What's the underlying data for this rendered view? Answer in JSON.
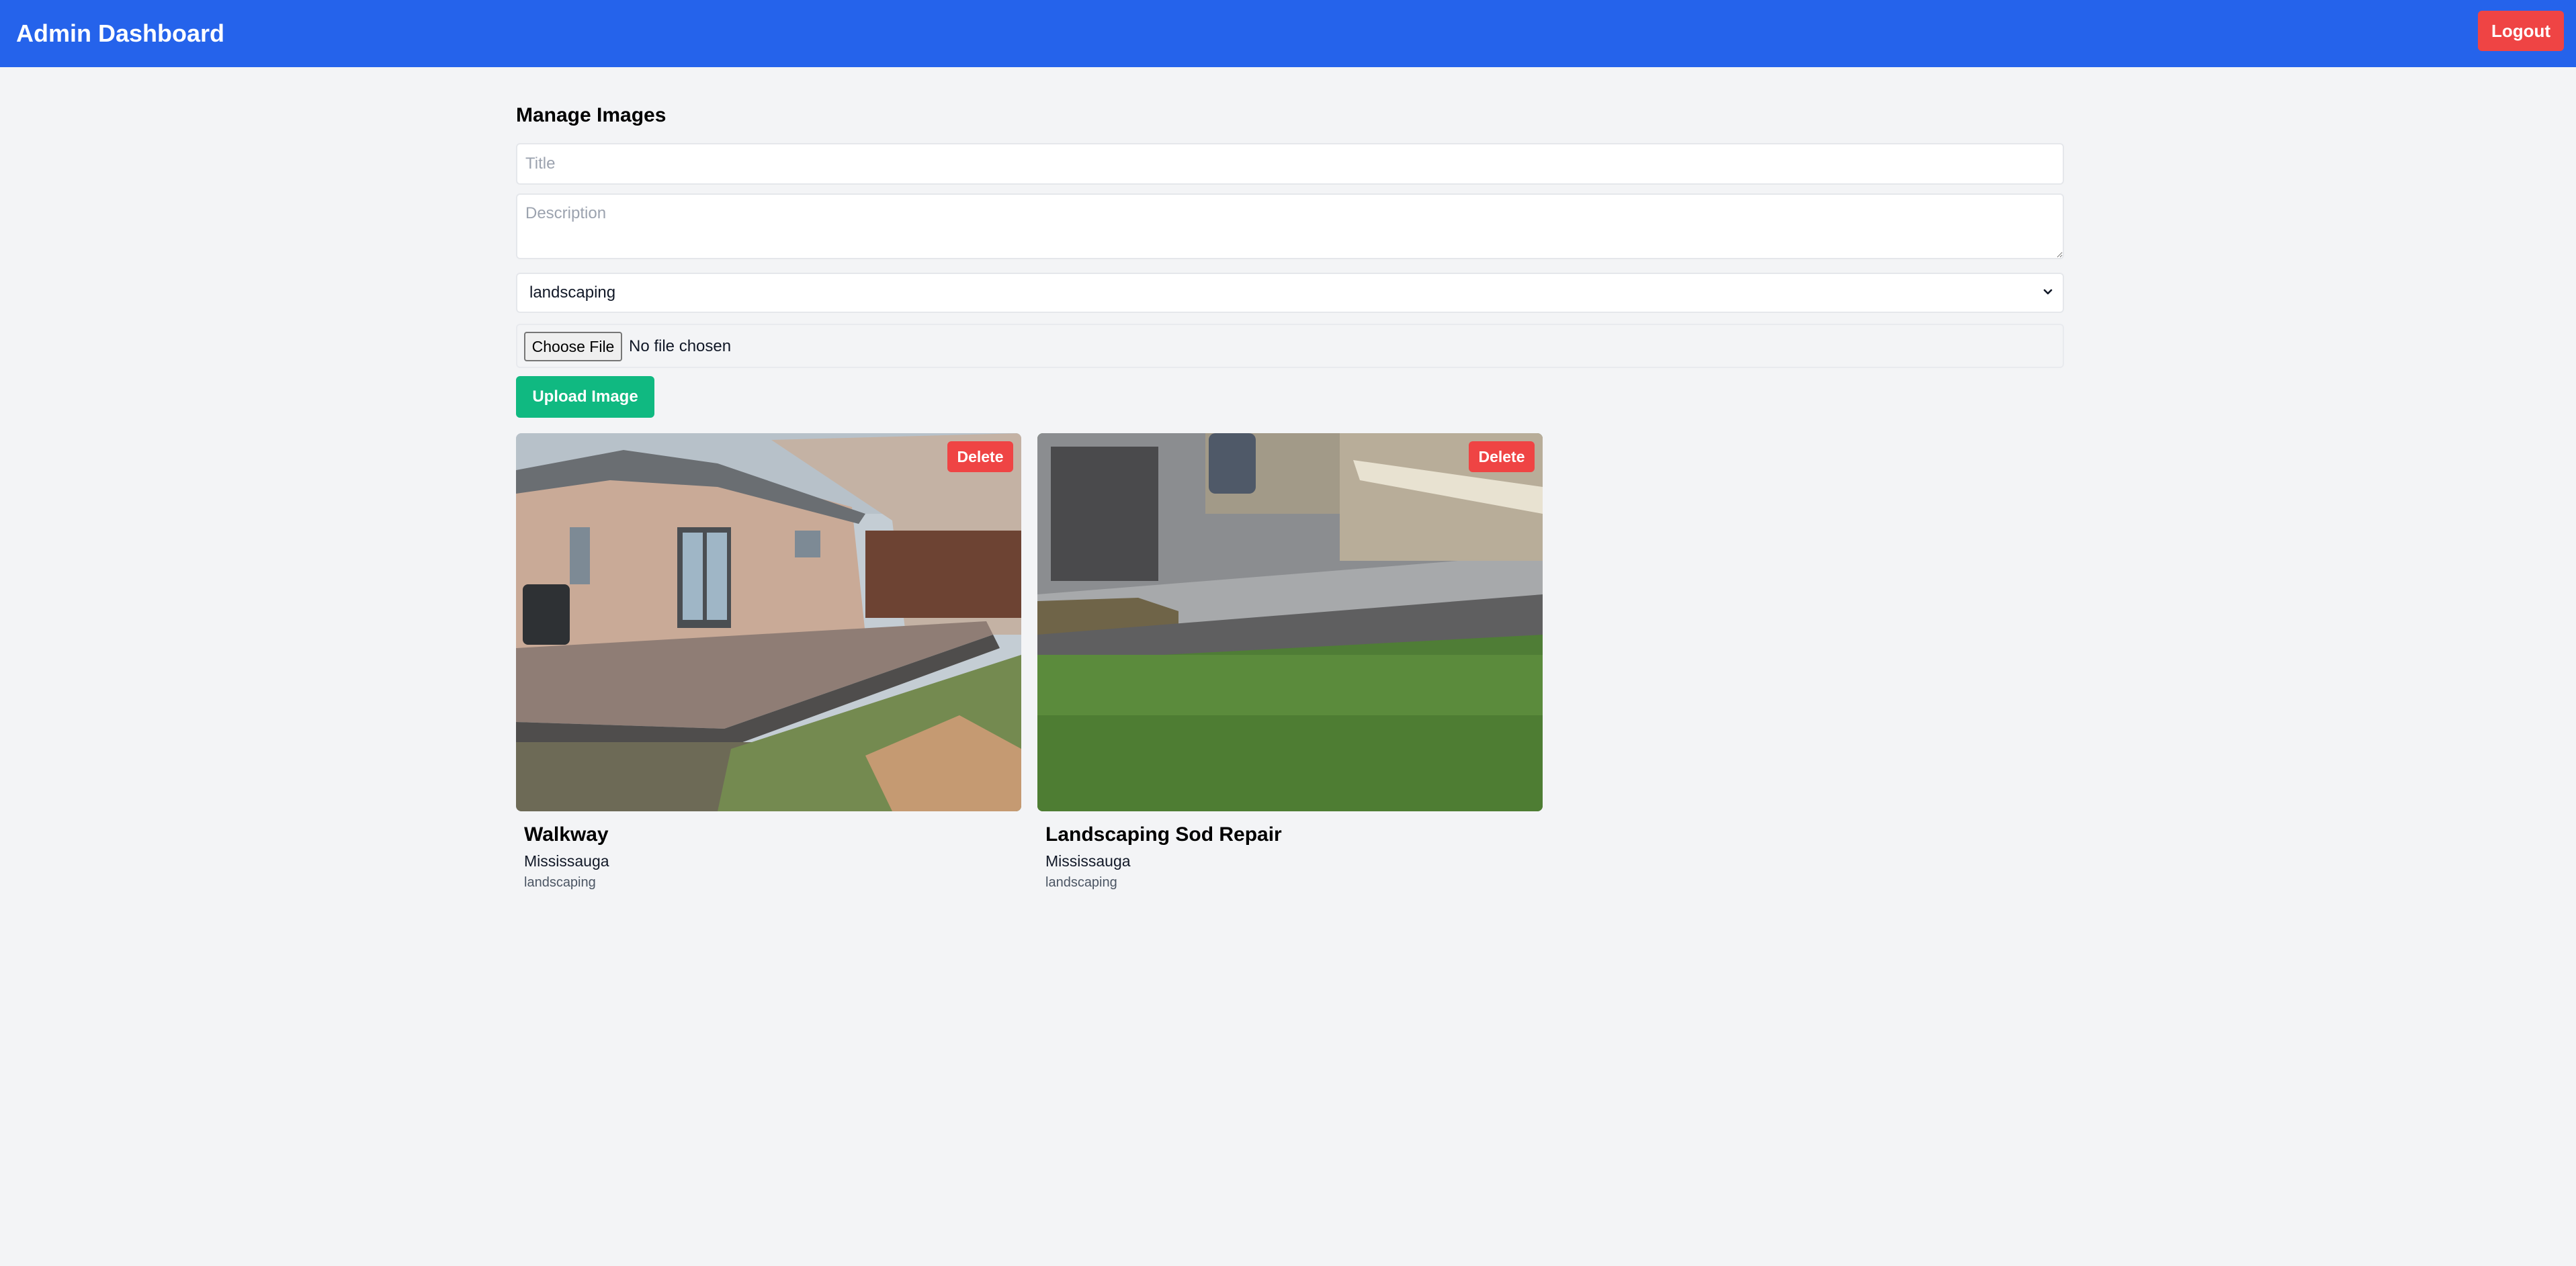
{
  "header": {
    "title": "Admin Dashboard",
    "logout_label": "Logout"
  },
  "manage": {
    "section_title": "Manage Images",
    "title_input": {
      "placeholder": "Title",
      "value": ""
    },
    "description_input": {
      "placeholder": "Description",
      "value": ""
    },
    "category_select": {
      "value": "landscaping"
    },
    "file_input": {
      "button_label": "Choose File",
      "status": "No file chosen"
    },
    "upload_label": "Upload Image"
  },
  "gallery": {
    "items": [
      {
        "title": "Walkway",
        "location": "Mississauga",
        "category": "landscaping",
        "delete_label": "Delete"
      },
      {
        "title": "Landscaping Sod Repair",
        "location": "Mississauga",
        "category": "landscaping",
        "delete_label": "Delete"
      }
    ]
  },
  "colors": {
    "header_bg": "#2563eb",
    "page_bg": "#f3f4f6",
    "danger": "#ef4444",
    "success": "#10b981"
  },
  "icons": {
    "select_arrow": "chevron-down-icon"
  }
}
